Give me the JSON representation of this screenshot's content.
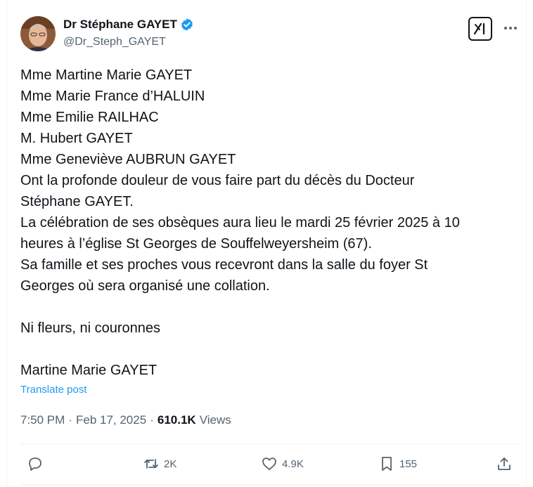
{
  "author": {
    "name": "Dr Stéphane GAYET",
    "handle": "@Dr_Steph_GAYET",
    "verified": true
  },
  "post": {
    "lines": [
      "Mme Martine Marie GAYET",
      "Mme Marie France d’HALUIN",
      "Mme Emilie RAILHAC",
      "M. Hubert GAYET",
      "Mme Geneviève AUBRUN GAYET",
      "Ont la profonde douleur de vous faire part du décès du Docteur",
      "Stéphane GAYET.",
      "La célébration de ses obsèques aura lieu le mardi 25 février 2025 à 10",
      "heures à l’église St Georges de Souffelweyersheim (67).",
      "Sa famille et ses proches vous recevront dans la salle du foyer St",
      "Georges où sera organisé une collation."
    ],
    "closing": "Ni fleurs, ni couronnes",
    "signature": "Martine Marie GAYET",
    "translate_label": "Translate post"
  },
  "meta": {
    "time": "7:50 PM",
    "separator": "·",
    "date": "Feb 17, 2025",
    "views_count": "610.1K",
    "views_label": "Views"
  },
  "actions": {
    "reposts": "2K",
    "likes": "4.9K",
    "bookmarks": "155"
  },
  "colors": {
    "verified": "#1d9bf0",
    "link": "#1d9bf0",
    "muted": "#536471",
    "text": "#0f1419"
  }
}
